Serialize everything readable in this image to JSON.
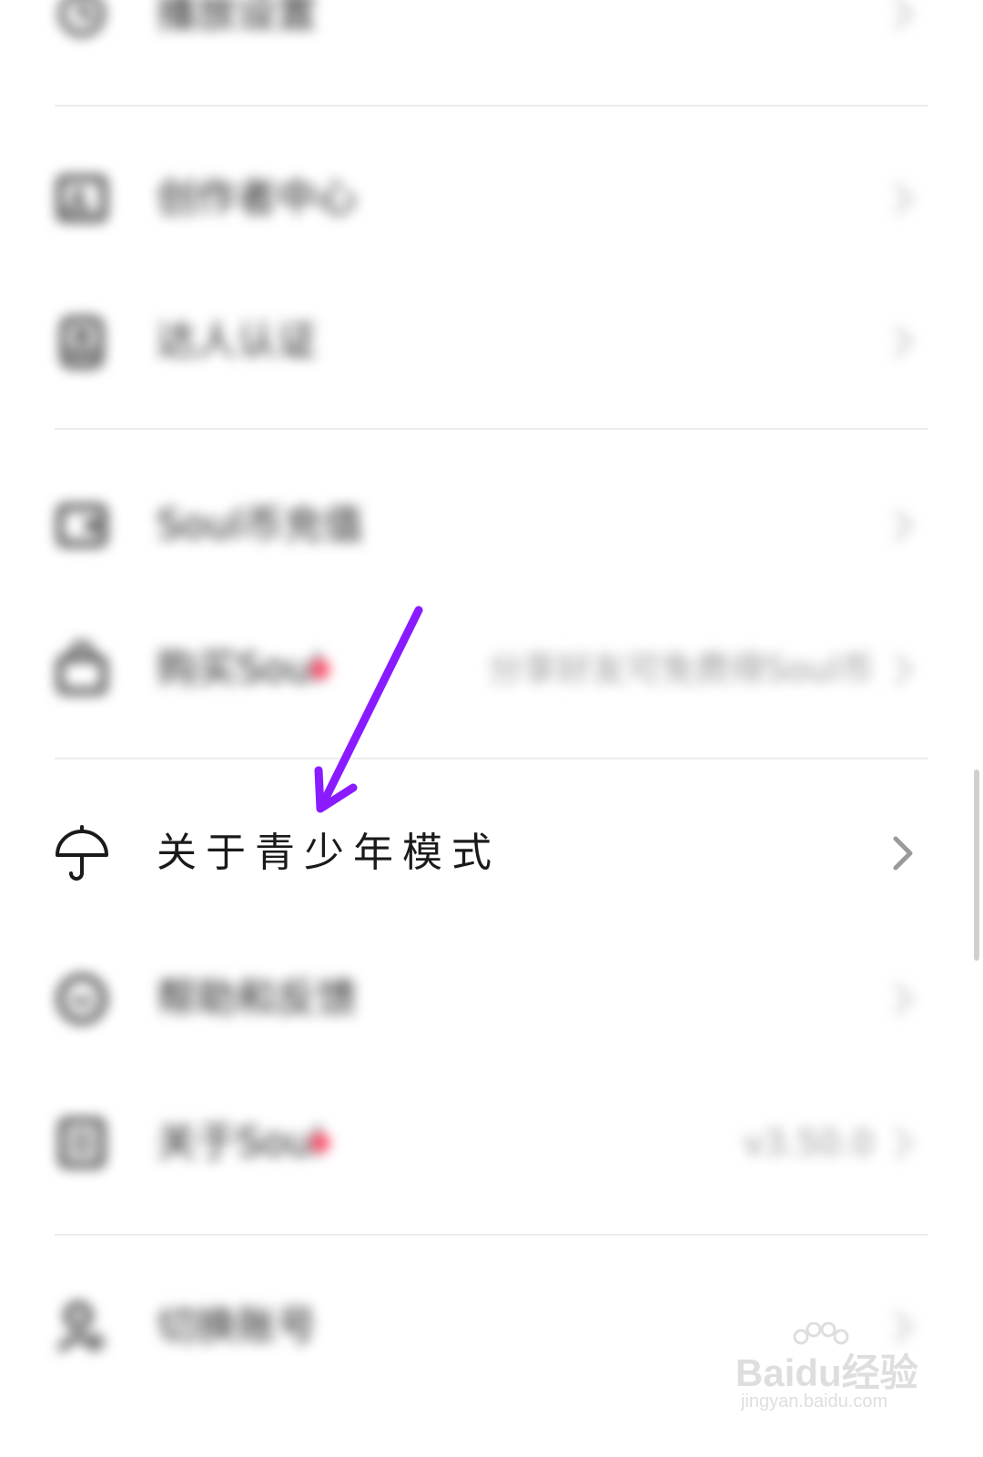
{
  "settings": {
    "rows": [
      {
        "label": "播放设置",
        "value": "",
        "icon": "history-icon",
        "dot": false
      },
      {
        "label": "创作者中心",
        "value": "",
        "icon": "creator-icon",
        "dot": false
      },
      {
        "label": "达人认证",
        "value": "",
        "icon": "verify-icon",
        "dot": false
      },
      {
        "label": "Soul币充值",
        "value": "",
        "icon": "wallet-icon",
        "dot": false
      },
      {
        "label": "购买Soul",
        "value": "分享好友可免费得Soul币",
        "icon": "bag-icon",
        "dot": true
      },
      {
        "label": "帮助和反馈",
        "value": "",
        "icon": "help-icon",
        "dot": false
      },
      {
        "label": "关于Soul",
        "value": "v3.50.0",
        "icon": "info-icon",
        "dot": true
      },
      {
        "label": "切换账号",
        "value": "",
        "icon": "account-icon",
        "dot": false
      }
    ],
    "focus_row": {
      "label": "关于青少年模式",
      "icon": "umbrella-icon"
    }
  },
  "annotation": {
    "color": "#8a1aff"
  },
  "watermark": {
    "brand": "Baidu经验",
    "url": "jingyan.baidu.com"
  }
}
